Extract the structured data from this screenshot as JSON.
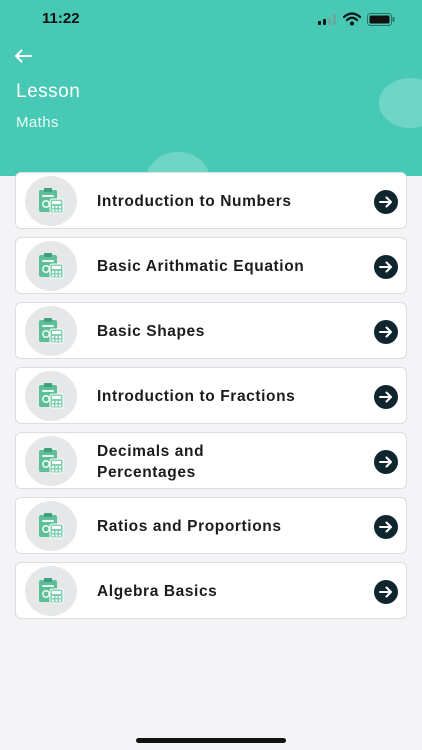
{
  "status_bar": {
    "time": "11:22"
  },
  "header": {
    "title": "Lesson",
    "subtitle": "Maths",
    "back_icon": "arrow-left-icon"
  },
  "lessons": [
    {
      "label": "Introduction to Numbers",
      "icon": "calculator-clipboard-icon"
    },
    {
      "label": "Basic Arithmatic Equation",
      "icon": "calculator-clipboard-icon"
    },
    {
      "label": "Basic Shapes",
      "icon": "calculator-clipboard-icon"
    },
    {
      "label": "Introduction to Fractions",
      "icon": "calculator-clipboard-icon"
    },
    {
      "label": "Decimals and Percentages",
      "icon": "calculator-clipboard-icon"
    },
    {
      "label": "Ratios and Proportions",
      "icon": "calculator-clipboard-icon"
    },
    {
      "label": "Algebra Basics",
      "icon": "calculator-clipboard-icon"
    }
  ],
  "colors": {
    "header": "#47c9b5",
    "icon_green": "#5dbf9a",
    "arrow_bg": "#10262e",
    "background": "#f4f4f6"
  }
}
